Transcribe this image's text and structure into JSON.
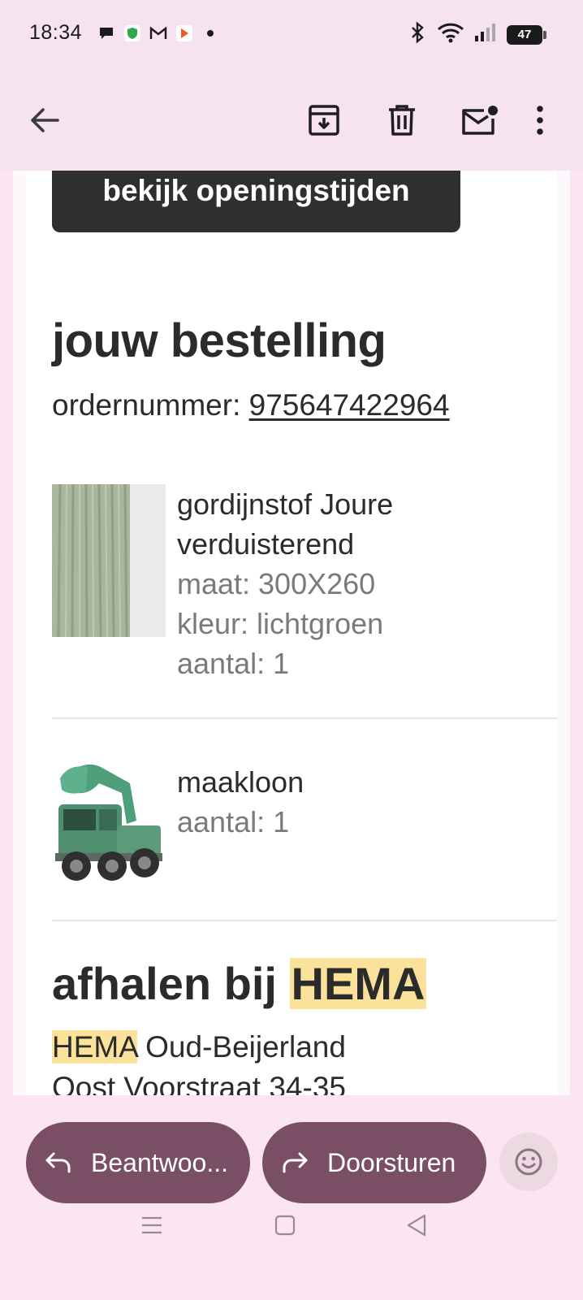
{
  "status_bar": {
    "time": "18:34",
    "battery": "47",
    "icons_left": [
      "chat-icon",
      "shield-icon",
      "gmail-icon",
      "play-icon",
      "dot-icon"
    ],
    "icons_right": [
      "bluetooth-icon",
      "wifi-icon",
      "signal-icon",
      "battery-icon"
    ]
  },
  "toolbar": {
    "back_icon": "arrow-left-icon",
    "archive_icon": "archive-icon",
    "delete_icon": "trash-icon",
    "mark_unread_icon": "mail-unread-icon",
    "more_icon": "more-vertical-icon"
  },
  "email": {
    "hours_button": "bekijk openingstijden",
    "order_title": "jouw bestelling",
    "order_label": "ordernummer:",
    "order_number": "975647422964",
    "products": [
      {
        "name_line1": "gordijnstof Joure",
        "name_line2": "verduisterend",
        "size": "maat: 300X260",
        "color": "kleur: lichtgroen",
        "quantity": "aantal: 1"
      },
      {
        "name_line1": "maakloon",
        "quantity": "aantal: 1"
      }
    ],
    "pickup_title_prefix": "afhalen bij",
    "pickup_title_highlight": "HEMA",
    "store_highlight": "HEMA",
    "store_name": "Oud-Beijerland",
    "store_street": "Oost Voorstraat 34-35"
  },
  "actions": {
    "reply_label": "Beantwoo...",
    "forward_label": "Doorsturen",
    "reply_icon": "reply-icon",
    "forward_icon": "forward-icon",
    "emoji_icon": "emoji-icon"
  },
  "nav": {
    "menu_icon": "menu-icon",
    "home_icon": "home-icon",
    "back_icon": "back-triangle-icon"
  },
  "colors": {
    "background": "#fae5f1",
    "pill": "#7a4f66",
    "highlight": "#fbe29a",
    "dark_button": "#2f2f2f"
  }
}
